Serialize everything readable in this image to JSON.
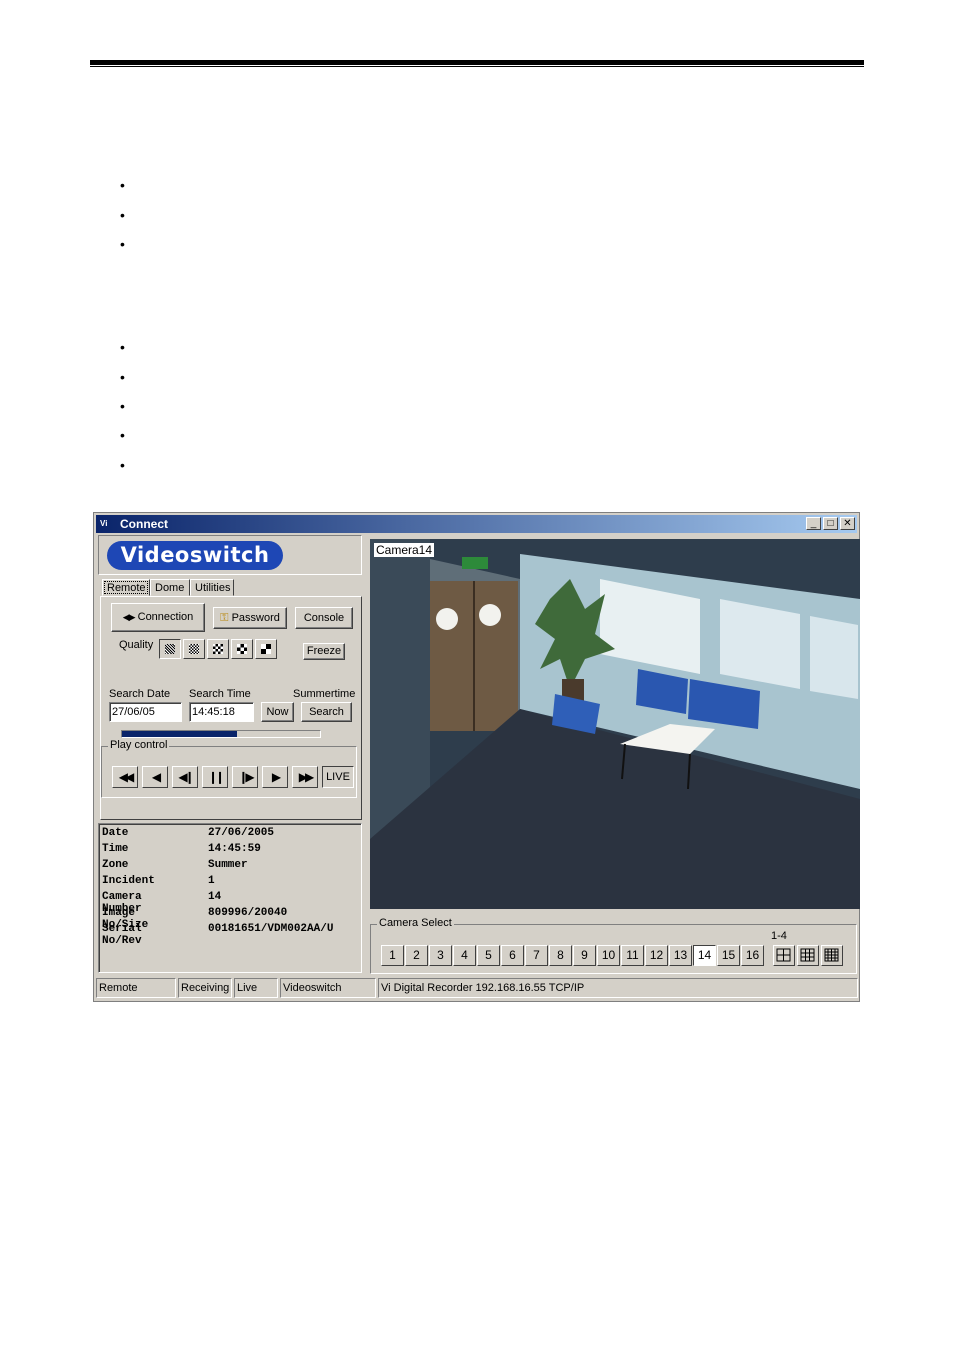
{
  "window": {
    "title": "Connect",
    "app_icon": "Vi"
  },
  "logo": "Videoswitch",
  "tabs": [
    "Remote",
    "Dome",
    "Utilities"
  ],
  "buttons": {
    "connection": "Connection",
    "password": "Password",
    "console": "Console",
    "freeze": "Freeze",
    "now": "Now",
    "search": "Search",
    "live": "LIVE"
  },
  "quality": {
    "label": "Quality",
    "progress_fraction": 0.58
  },
  "search": {
    "date_label": "Search Date",
    "time_label": "Search Time",
    "summertime_label": "Summertime",
    "date_value": "27/06/05",
    "time_value": "14:45:18"
  },
  "play_control": {
    "label": "Play control"
  },
  "info": [
    {
      "key": "Date",
      "value": "27/06/2005"
    },
    {
      "key": "Time",
      "value": "14:45:59"
    },
    {
      "key": "Zone",
      "value": "Summer"
    },
    {
      "key": "Incident",
      "value": "1"
    },
    {
      "key": "Camera Number",
      "value": "14"
    },
    {
      "key": "Image No/Size",
      "value": "809996/20040"
    },
    {
      "key": "Serial No/Rev",
      "value": "00181651/VDM002AA/U"
    }
  ],
  "camera": {
    "label": "Camera14"
  },
  "camera_select": {
    "title": "Camera Select",
    "cameras": [
      "1",
      "2",
      "3",
      "4",
      "5",
      "6",
      "7",
      "8",
      "9",
      "10",
      "11",
      "12",
      "13",
      "14",
      "15",
      "16"
    ],
    "selected": "14",
    "range_label": "1-4"
  },
  "status": [
    "Remote",
    "Receiving",
    "Live",
    "Videoswitch",
    "Vi Digital Recorder   192.168.16.55   TCP/IP"
  ]
}
